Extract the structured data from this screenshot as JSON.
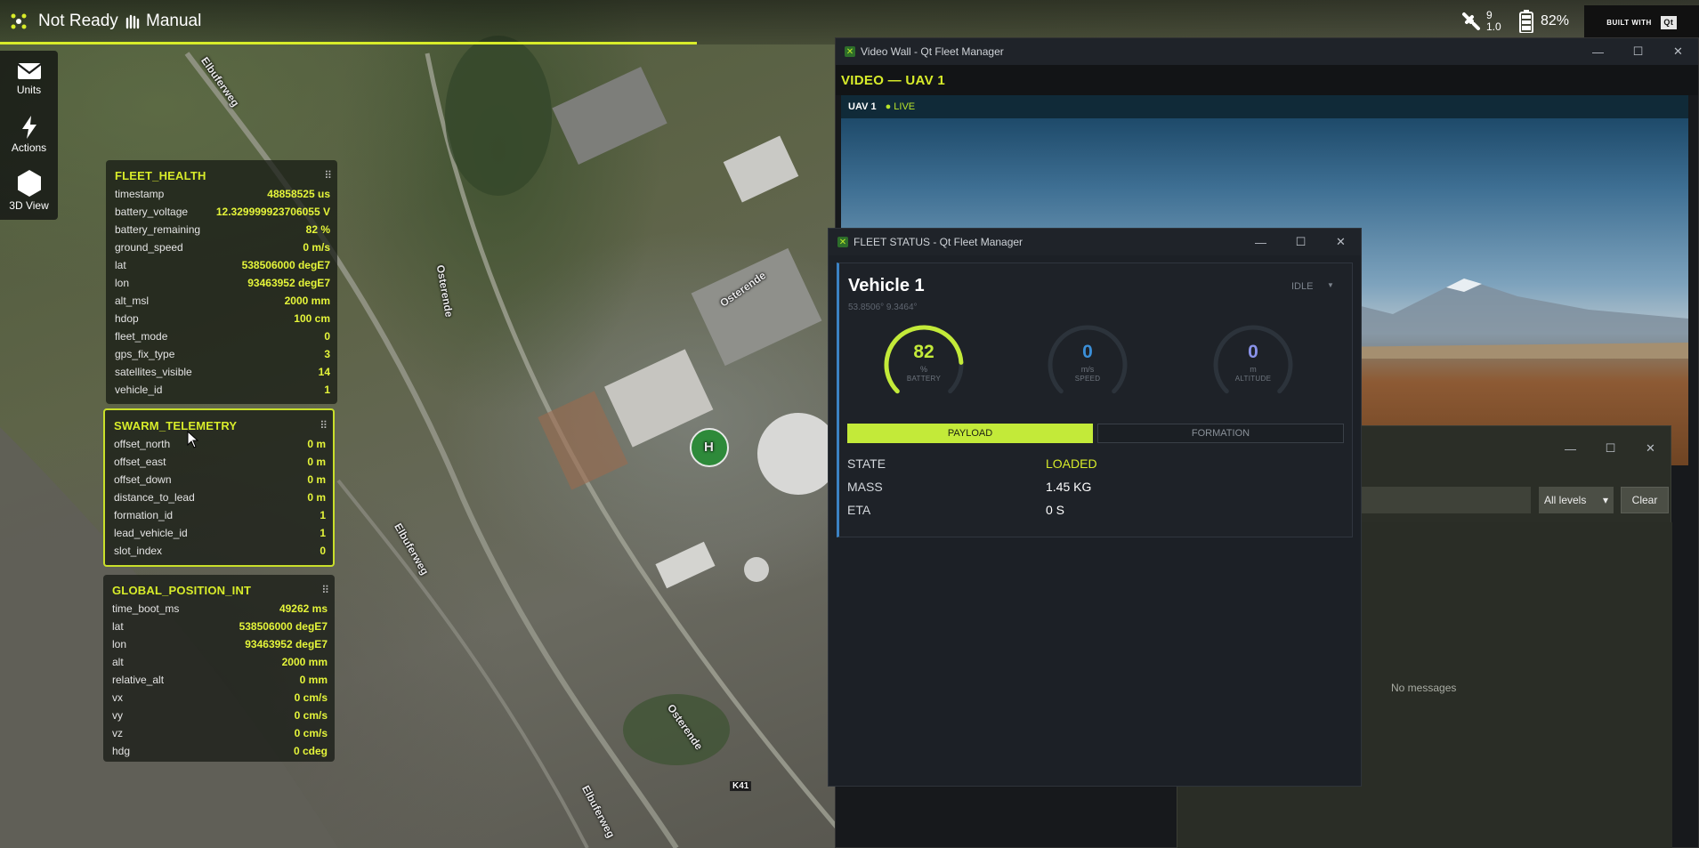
{
  "topbar": {
    "status": "Not Ready",
    "mode": "Manual",
    "satellites": "9",
    "hdop": "1.0",
    "battery": "82%",
    "built_with": "BUILT WITH",
    "qt_logo": "Qt",
    "progress_fraction": 0.41,
    "icons": {
      "system": "drone-icon",
      "mode": "manual-mode-icon",
      "gps": "satellite-icon",
      "battery": "battery-icon"
    },
    "accent": "#d8ec2a"
  },
  "toolbar": {
    "items": [
      {
        "label": "Units",
        "icon": "envelope-icon"
      },
      {
        "label": "Actions",
        "icon": "lightning-icon"
      },
      {
        "label": "3D View",
        "icon": "hexagon-icon"
      }
    ]
  },
  "map": {
    "labels": [
      "Elbuferweg",
      "Osterende",
      "Osterende",
      "Elbuferweg",
      "Osterende",
      "Elbuferweg",
      "K41",
      "H"
    ]
  },
  "panels": [
    {
      "title": "FLEET_HEALTH",
      "rows": [
        {
          "k": "timestamp",
          "v": "48858525 us"
        },
        {
          "k": "battery_voltage",
          "v": "12.329999923706055 V"
        },
        {
          "k": "battery_remaining",
          "v": "82 %"
        },
        {
          "k": "ground_speed",
          "v": "0 m/s"
        },
        {
          "k": "lat",
          "v": "538506000 degE7"
        },
        {
          "k": "lon",
          "v": "93463952 degE7"
        },
        {
          "k": "alt_msl",
          "v": "2000 mm"
        },
        {
          "k": "hdop",
          "v": "100 cm"
        },
        {
          "k": "fleet_mode",
          "v": "0"
        },
        {
          "k": "gps_fix_type",
          "v": "3"
        },
        {
          "k": "satellites_visible",
          "v": "14"
        },
        {
          "k": "vehicle_id",
          "v": "1"
        }
      ]
    },
    {
      "title": "SWARM_TELEMETRY",
      "rows": [
        {
          "k": "offset_north",
          "v": "0 m"
        },
        {
          "k": "offset_east",
          "v": "0 m"
        },
        {
          "k": "offset_down",
          "v": "0 m"
        },
        {
          "k": "distance_to_lead",
          "v": "0 m"
        },
        {
          "k": "formation_id",
          "v": "1"
        },
        {
          "k": "lead_vehicle_id",
          "v": "1"
        },
        {
          "k": "slot_index",
          "v": "0"
        }
      ]
    },
    {
      "title": "GLOBAL_POSITION_INT",
      "rows": [
        {
          "k": "time_boot_ms",
          "v": "49262 ms"
        },
        {
          "k": "lat",
          "v": "538506000 degE7"
        },
        {
          "k": "lon",
          "v": "93463952 degE7"
        },
        {
          "k": "alt",
          "v": "2000 mm"
        },
        {
          "k": "relative_alt",
          "v": "0 mm"
        },
        {
          "k": "vx",
          "v": "0 cm/s"
        },
        {
          "k": "vy",
          "v": "0 cm/s"
        },
        {
          "k": "vz",
          "v": "0 cm/s"
        },
        {
          "k": "hdg",
          "v": "0 cdeg"
        }
      ]
    }
  ],
  "video_wall": {
    "window_title": "Video Wall - Qt Fleet Manager",
    "header": "VIDEO — UAV 1",
    "feed_label": "UAV 1",
    "live": "● LIVE"
  },
  "messages": {
    "levels": "All levels",
    "clear": "Clear",
    "empty": "No messages"
  },
  "fleet_status": {
    "window_title": "FLEET STATUS - Qt Fleet Manager",
    "vehicle_name": "Vehicle 1",
    "coords": "53.8506°  9.3464°",
    "state": "IDLE",
    "state_caret": "▼",
    "gauges": [
      {
        "value": "82",
        "unit": "%",
        "label": "BATTERY",
        "fraction": 0.82,
        "color": "#c3ea39"
      },
      {
        "value": "0",
        "unit": "m/s",
        "label": "SPEED",
        "fraction": 0,
        "color": "#3b8fd8"
      },
      {
        "value": "0",
        "unit": "m",
        "label": "ALTITUDE",
        "fraction": 0,
        "color": "#8a93ea"
      }
    ],
    "tabs": {
      "payload": "PAYLOAD",
      "formation": "FORMATION"
    },
    "payload": [
      {
        "k": "STATE",
        "v": "LOADED"
      },
      {
        "k": "MASS",
        "v": "1.45 KG"
      },
      {
        "k": "ETA",
        "v": "0 S"
      }
    ]
  },
  "window_controls": {
    "minimize": "—",
    "maximize": "☐",
    "close": "✕"
  }
}
